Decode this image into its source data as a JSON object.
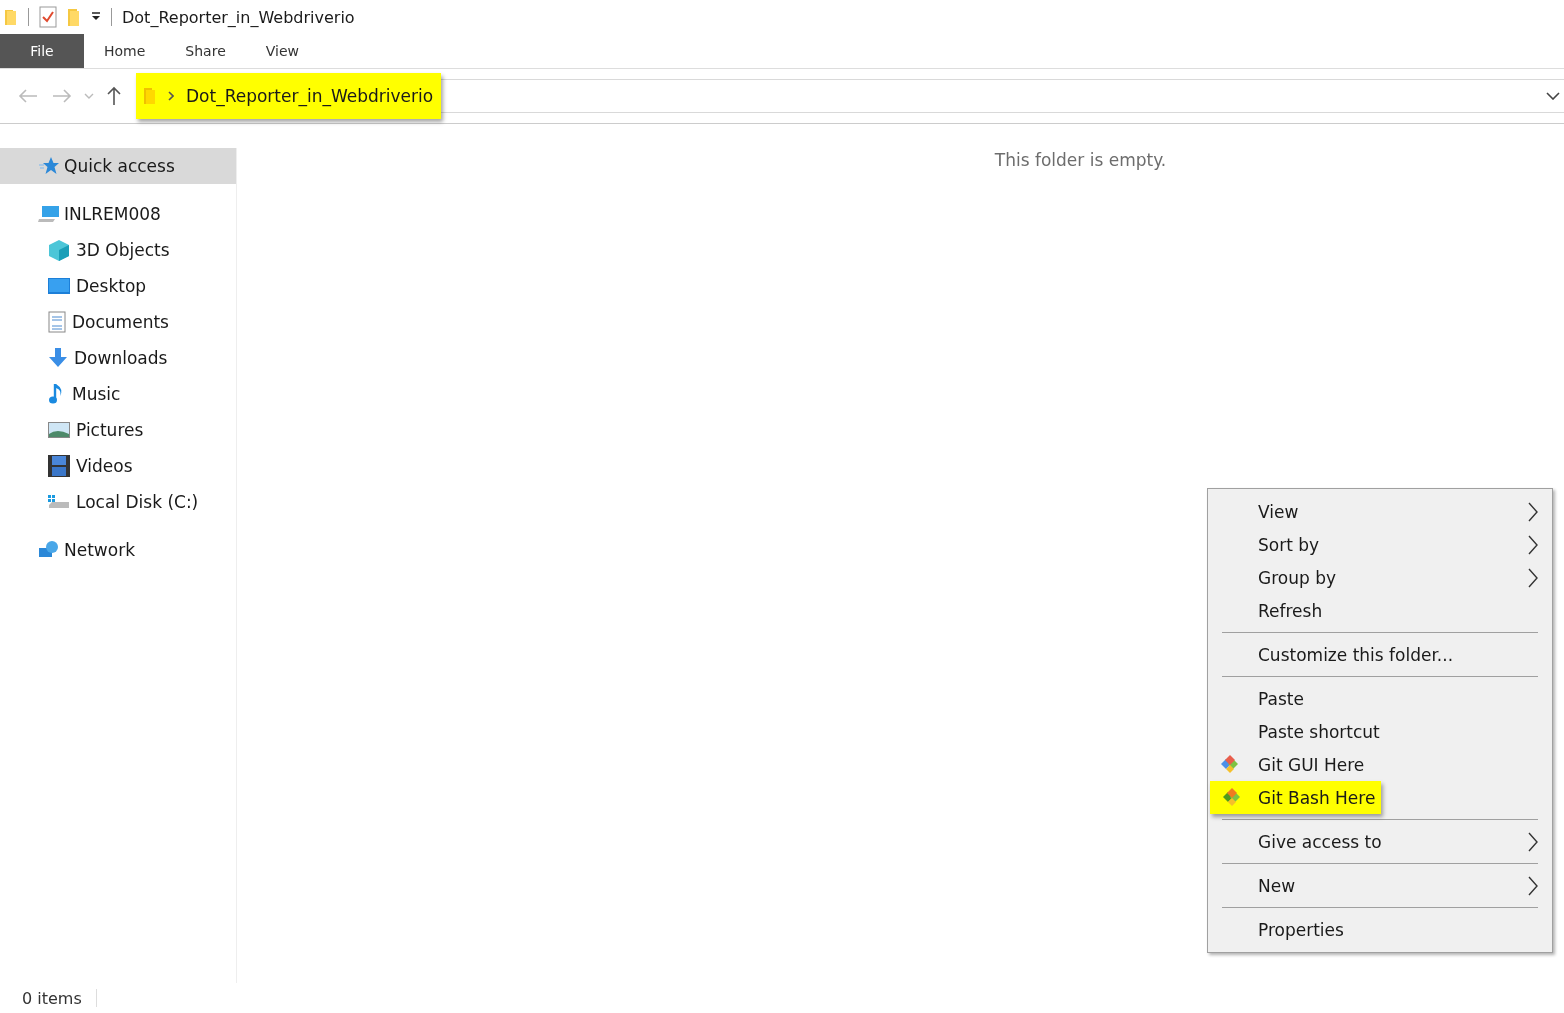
{
  "window": {
    "title": "Dot_Reporter_in_Webdriverio"
  },
  "ribbon_tabs": [
    {
      "label": "File",
      "selected": true
    },
    {
      "label": "Home",
      "selected": false
    },
    {
      "label": "Share",
      "selected": false
    },
    {
      "label": "View",
      "selected": false
    }
  ],
  "address_bar": {
    "path": "Dot_Reporter_in_Webdriverio",
    "highlighted": true
  },
  "sidebar": {
    "items": [
      {
        "label": "Quick access",
        "kind": "star",
        "selected": true
      },
      {
        "label": "INLREM008",
        "kind": "computer",
        "selected": false,
        "children": [
          {
            "label": "3D Objects",
            "kind": "cube",
            "selected": false
          },
          {
            "label": "Desktop",
            "kind": "desktop",
            "selected": false
          },
          {
            "label": "Documents",
            "kind": "document",
            "selected": false
          },
          {
            "label": "Downloads",
            "kind": "download",
            "selected": false
          },
          {
            "label": "Music",
            "kind": "music",
            "selected": false
          },
          {
            "label": "Pictures",
            "kind": "picture",
            "selected": false
          },
          {
            "label": "Videos",
            "kind": "video",
            "selected": false
          },
          {
            "label": "Local Disk (C:)",
            "kind": "disk",
            "selected": false
          }
        ]
      },
      {
        "label": "Network",
        "kind": "network",
        "selected": false
      }
    ]
  },
  "content": {
    "empty_message": "This folder is empty."
  },
  "context_menu": {
    "groups": [
      [
        {
          "label": "View",
          "kind": "plain",
          "submenu": true,
          "highlighted": false
        },
        {
          "label": "Sort by",
          "kind": "plain",
          "submenu": true,
          "highlighted": false
        },
        {
          "label": "Group by",
          "kind": "plain",
          "submenu": true,
          "highlighted": false
        },
        {
          "label": "Refresh",
          "kind": "plain",
          "submenu": false,
          "highlighted": false
        }
      ],
      [
        {
          "label": "Customize this folder...",
          "kind": "plain",
          "submenu": false,
          "highlighted": false
        }
      ],
      [
        {
          "label": "Paste",
          "kind": "plain",
          "submenu": false,
          "highlighted": false
        },
        {
          "label": "Paste shortcut",
          "kind": "plain",
          "submenu": false,
          "highlighted": false
        },
        {
          "label": "Git GUI Here",
          "kind": "git-gui",
          "submenu": false,
          "highlighted": false
        },
        {
          "label": "Git Bash Here",
          "kind": "git-bash",
          "submenu": false,
          "highlighted": true
        }
      ],
      [
        {
          "label": "Give access to",
          "kind": "plain",
          "submenu": true,
          "highlighted": false
        }
      ],
      [
        {
          "label": "New",
          "kind": "plain",
          "submenu": true,
          "highlighted": false
        }
      ],
      [
        {
          "label": "Properties",
          "kind": "plain",
          "submenu": false,
          "highlighted": false
        }
      ]
    ]
  },
  "status_bar": {
    "items_count": "0 items"
  }
}
